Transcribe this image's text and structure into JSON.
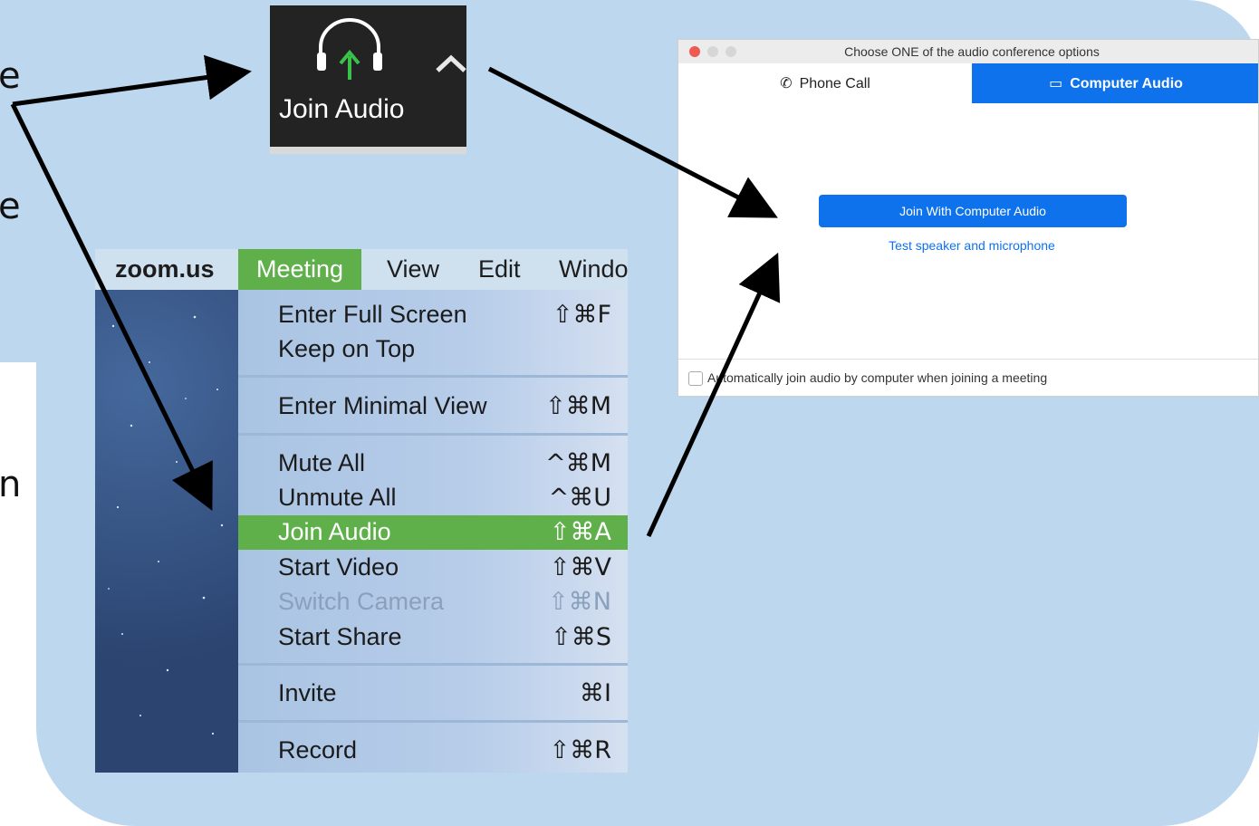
{
  "toolbar": {
    "join_audio_label": "Join Audio"
  },
  "menu": {
    "app_name": "zoom.us",
    "bar_items": [
      "Meeting",
      "View",
      "Edit",
      "Windo"
    ],
    "items": [
      {
        "label": "Enter Full Screen",
        "shortcut": "⇧⌘F"
      },
      {
        "label": "Keep on Top",
        "shortcut": ""
      },
      {
        "label": "Enter Minimal View",
        "shortcut": "⇧⌘M"
      },
      {
        "label": "Mute All",
        "shortcut": "^⌘M"
      },
      {
        "label": "Unmute All",
        "shortcut": "^⌘U"
      },
      {
        "label": "Join Audio",
        "shortcut": "⇧⌘A",
        "highlighted": true
      },
      {
        "label": "Start Video",
        "shortcut": "⇧⌘V"
      },
      {
        "label": "Switch Camera",
        "shortcut": "⇧⌘N",
        "disabled": true
      },
      {
        "label": "Start Share",
        "shortcut": "⇧⌘S"
      },
      {
        "label": "Invite",
        "shortcut": "⌘I"
      },
      {
        "label": "Record",
        "shortcut": "⇧⌘R"
      }
    ],
    "highlight_color": "#5fb04a"
  },
  "dialog": {
    "title": "Choose ONE of the audio conference options",
    "tab_phone": "Phone Call",
    "tab_computer": "Computer Audio",
    "join_button": "Join With Computer Audio",
    "test_link": "Test speaker and microphone",
    "auto_join": "Automatically join audio by computer when joining a meeting",
    "accent_color": "#0e72ed"
  },
  "slide": {
    "edge_letters": [
      "e",
      "e",
      "n"
    ],
    "background_color": "#bdd7ee"
  },
  "icons": [
    "headphones-icon",
    "up-arrow-icon",
    "chevron-up-icon",
    "phone-icon",
    "laptop-icon"
  ]
}
